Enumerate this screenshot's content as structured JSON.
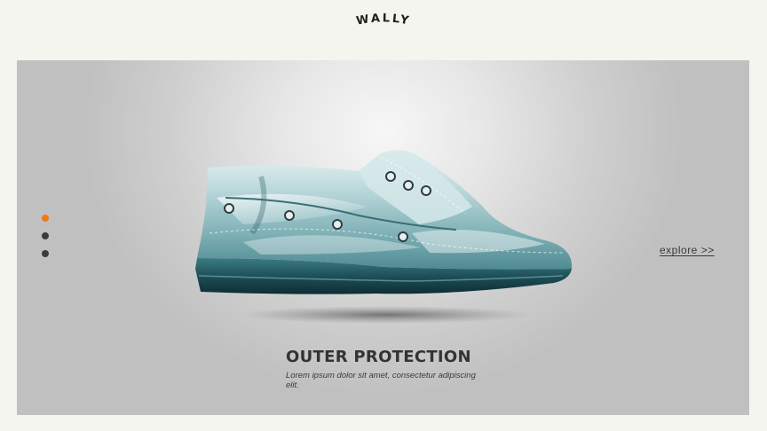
{
  "header": {
    "logo_text": "WALLY"
  },
  "slider": {
    "pagination": [
      {
        "state": "active"
      },
      {
        "state": "inactive"
      },
      {
        "state": "inactive"
      }
    ],
    "accent_color": "#f07a12",
    "dot_color": "#3b3b3b",
    "image": "ice-water-boat-shoe",
    "explore_label": "explore >>",
    "title": "OUTER PROTECTION",
    "description": "Lorem ipsum dolor sit amet, consectetur adipiscing elit."
  }
}
